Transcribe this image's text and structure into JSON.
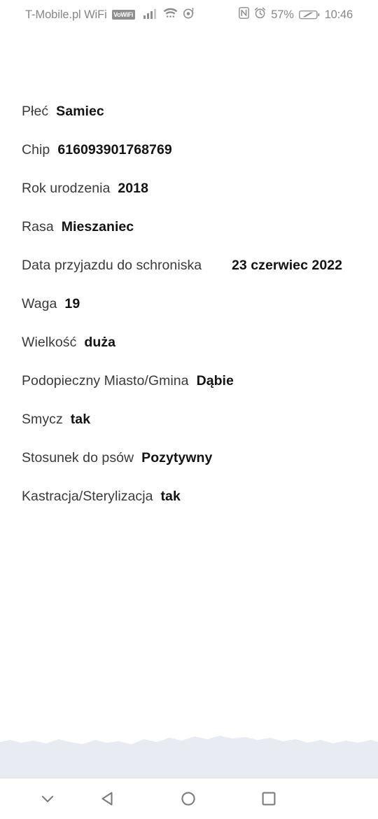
{
  "status_bar": {
    "carrier": "T-Mobile.pl WiFi",
    "vowifi_badge": "VoWiFi",
    "signal_icon": "signal-bars-icon",
    "wifi_icon": "wifi-icon",
    "hotspot_icon": "hotspot-icon",
    "nfc_icon": "nfc-icon",
    "alarm_icon": "alarm-clock-icon",
    "battery_percent": "57%",
    "battery_icon": "battery-icon",
    "time": "10:46"
  },
  "details": {
    "rows": [
      {
        "label": "Płeć",
        "value": "Samiec",
        "wrap": false
      },
      {
        "label": "Chip",
        "value": "616093901768769",
        "wrap": false
      },
      {
        "label": "Rok urodzenia",
        "value": "2018",
        "wrap": false
      },
      {
        "label": "Rasa",
        "value": "Mieszaniec",
        "wrap": false
      },
      {
        "label": "Data przyjazdu do schroniska",
        "value": "23 czerwiec 2022",
        "wrap": true
      },
      {
        "label": "Waga",
        "value": "19",
        "wrap": false
      },
      {
        "label": "Wielkość",
        "value": "duża",
        "wrap": false
      },
      {
        "label": "Podopieczny Miasto/Gmina",
        "value": "Dąbie",
        "wrap": false
      },
      {
        "label": "Smycz",
        "value": "tak",
        "wrap": false
      },
      {
        "label": "Stosunek do psów",
        "value": "Pozytywny",
        "wrap": false
      },
      {
        "label": "Kastracja/Sterylizacja",
        "value": "tak",
        "wrap": false
      }
    ]
  },
  "nav_bar": {
    "collapse_icon": "chevron-down-icon",
    "back_icon": "back-triangle-icon",
    "home_icon": "home-circle-icon",
    "recents_icon": "recents-square-icon"
  },
  "colors": {
    "page_background": "#ffffff",
    "label_text": "#3a3a3a",
    "value_text": "#131313",
    "status_text": "#878787",
    "band_background": "#e9ebf3",
    "nav_icon": "#7b7b80"
  }
}
